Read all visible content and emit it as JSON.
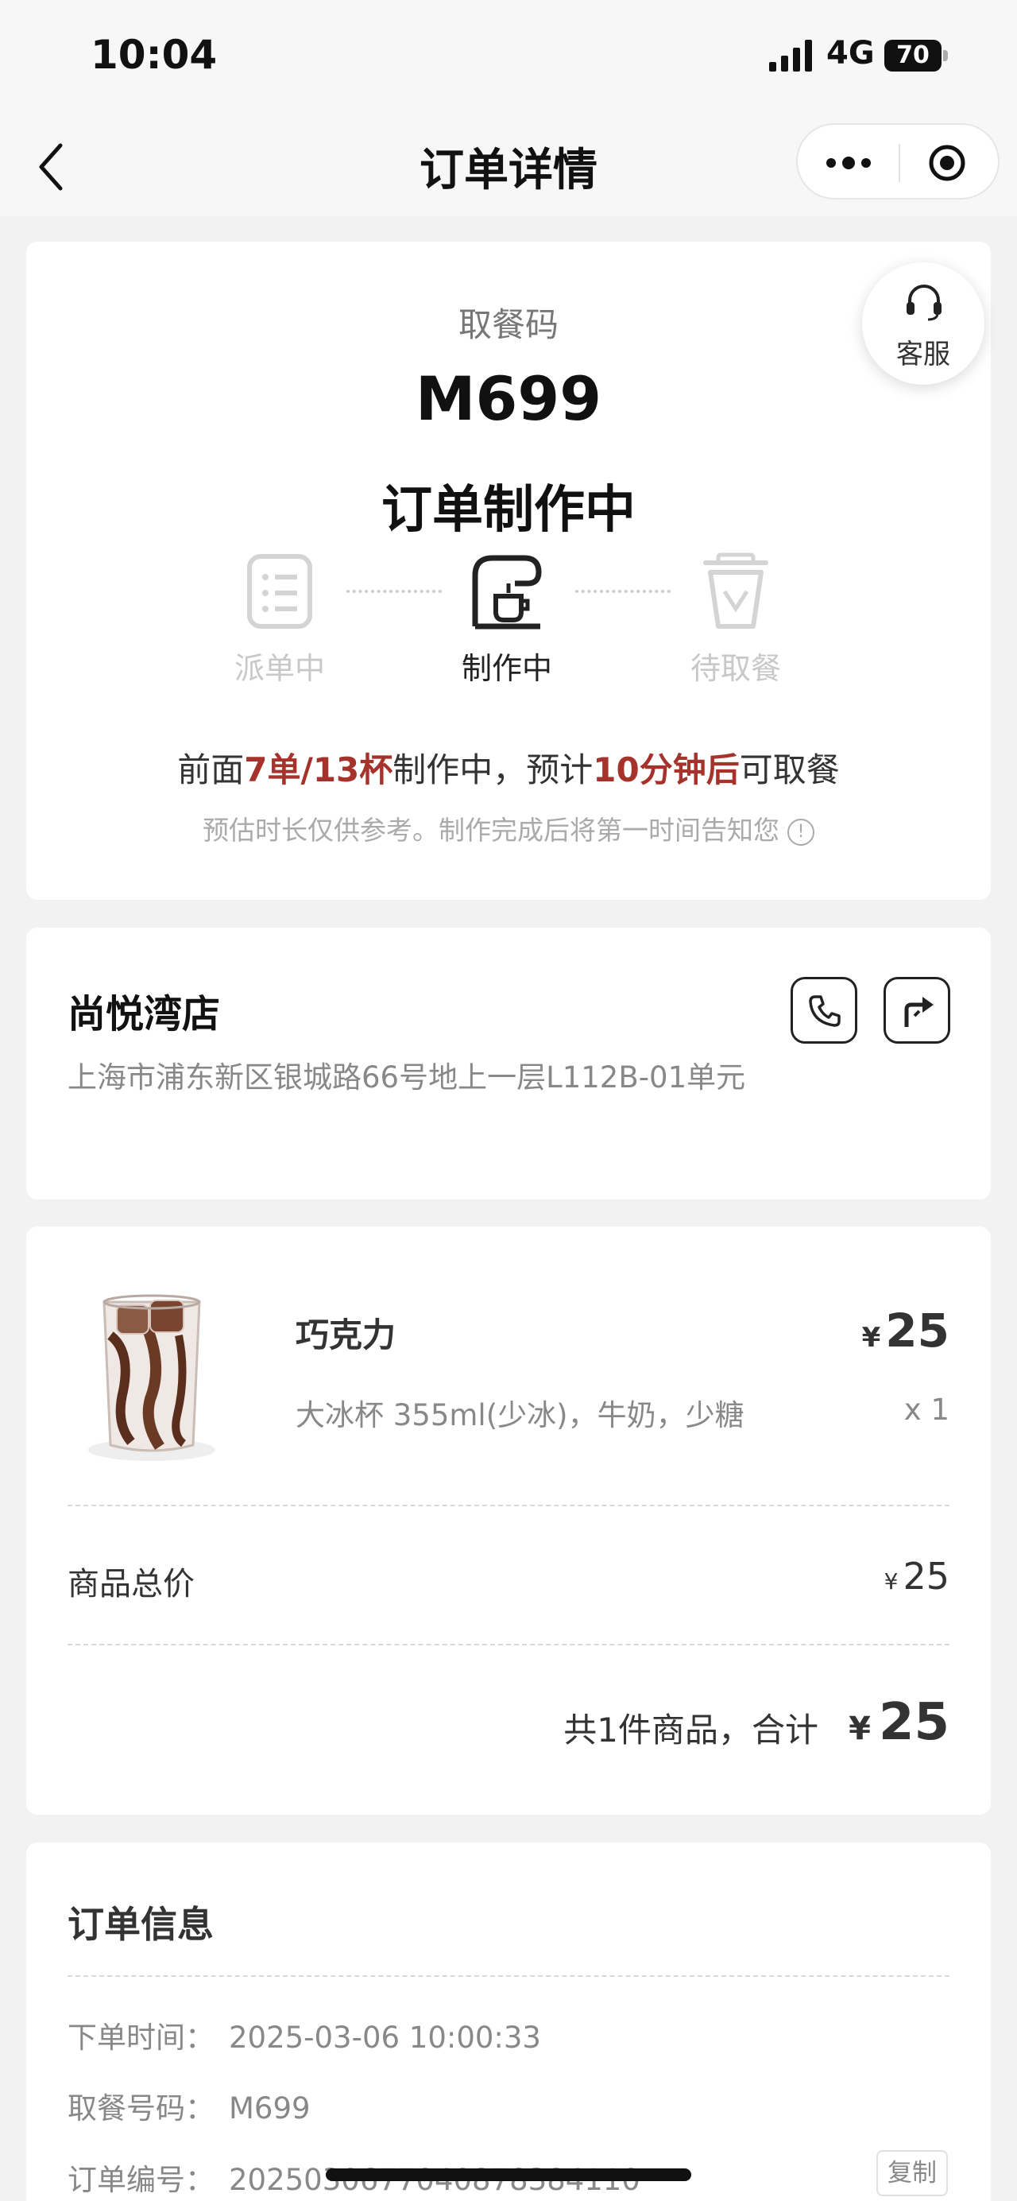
{
  "status_bar": {
    "time": "10:04",
    "network": "4G",
    "battery": "70"
  },
  "nav": {
    "title": "订单详情",
    "back_icon": "chevron-left-icon",
    "more_icon": "more-dots-icon",
    "close_icon": "target-circle-icon"
  },
  "customer_service": {
    "label": "客服",
    "icon": "headset-icon"
  },
  "pickup": {
    "label": "取餐码",
    "code": "M699",
    "status_title": "订单制作中",
    "steps": [
      {
        "label": "派单中",
        "icon": "order-list-icon",
        "active": false
      },
      {
        "label": "制作中",
        "icon": "coffee-machine-icon",
        "active": true
      },
      {
        "label": "待取餐",
        "icon": "cup-icon",
        "active": false
      }
    ],
    "eta": {
      "prefix": "前面",
      "queue": "7单/13杯",
      "middle": "制作中，预计",
      "wait": "10分钟后",
      "suffix": "可取餐"
    },
    "note": "预估时长仅供参考。制作完成后将第一时间告知您"
  },
  "store": {
    "name": "尚悦湾店",
    "address": "上海市浦东新区银城路66号地上一层L112B-01单元",
    "phone_icon": "phone-icon",
    "nav_icon": "directions-icon"
  },
  "order_items": [
    {
      "name": "巧克力",
      "spec": "大冰杯 355ml(少冰)，牛奶，少糖",
      "currency": "¥",
      "price": "25",
      "qty": "x 1"
    }
  ],
  "summary": {
    "subtotal_label": "商品总价",
    "subtotal_currency": "¥",
    "subtotal": "25",
    "total_label": "共1件商品，合计",
    "total_currency": "¥",
    "total": "25"
  },
  "order_info": {
    "title": "订单信息",
    "rows": [
      {
        "key": "下单时间：",
        "value": "2025-03-06 10:00:33"
      },
      {
        "key": "取餐号码：",
        "value": "M699"
      },
      {
        "key": "订单编号：",
        "value": "20250306770408783841​10"
      }
    ],
    "copy_label": "复制"
  },
  "colors": {
    "highlight": "#a5332c",
    "background": "#f2f2f2",
    "card": "#ffffff"
  }
}
